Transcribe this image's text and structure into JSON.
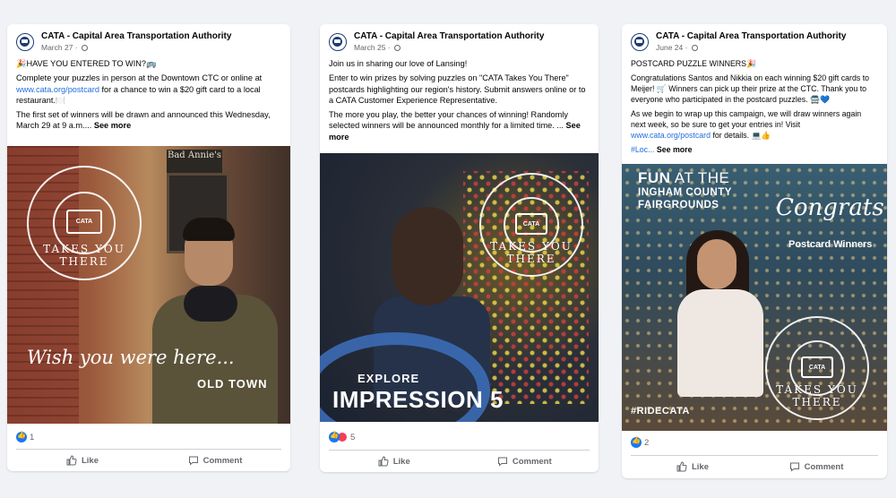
{
  "cards": [
    {
      "page_name": "CATA - Capital Area Transportation Authority",
      "date": "March 27",
      "meta_sep": " · ",
      "p1": "🎉HAVE YOU ENTERED TO WIN?🚌",
      "p2a": "Complete your puzzles in person at the Downtown CTC or online at ",
      "p2_link": "www.cata.org/postcard",
      "p2b": " for a chance to win a $20 gift card to a local restaurant.🍽️",
      "p3a": "The first set of winners will be drawn and announced this Wednesday, March 29 at 9 a.m.... ",
      "see_more": "See more",
      "image": {
        "sign": "Bad Annie's",
        "caption": "Wish you were here...",
        "place": "OLD TOWN",
        "badge_text": "TAKES YOU THERE",
        "badge_label": "CATA"
      },
      "reactions_count": "1",
      "like_label": "Like",
      "comment_label": "Comment"
    },
    {
      "page_name": "CATA - Capital Area Transportation Authority",
      "date": "March 25",
      "meta_sep": " · ",
      "p1": "Join us in sharing our love of Lansing!",
      "p2": "Enter to win prizes by solving puzzles on \"CATA Takes You There\" postcards highlighting our region's history. Submit answers online or to a CATA Customer Experience Representative.",
      "p3a": "The more you play, the better your chances of winning! Randomly selected winners will be announced monthly for a limited time. ... ",
      "see_more": "See more",
      "image": {
        "explore": "EXPLORE",
        "impression": "IMPRESSION 5",
        "badge_text": "TAKES YOU THERE",
        "badge_label": "CATA"
      },
      "reactions_count": "5",
      "like_label": "Like",
      "comment_label": "Comment"
    },
    {
      "page_name": "CATA - Capital Area Transportation Authority",
      "date": "June 24",
      "meta_sep": " · ",
      "p1": "POSTCARD PUZZLE WINNERS🎉",
      "p2": "Congratulations Santos and Nikkia on each winning $20 gift cards to Meijer! 🛒 Winners can pick up their prize at the CTC. Thank you to everyone who participated in the postcard puzzles. 🚍💙",
      "p3a": "As we begin to wrap up this campaign, we will draw winners again next week, so be sure to get your entries in! Visit ",
      "p3_link": "www.cata.org/postcard",
      "p3b": " for details. 💻👍",
      "p4a": "#Loc... ",
      "see_more": "See more",
      "image": {
        "fun_a": "FUN",
        "fun_b": " AT THE",
        "fair": "INGHAM COUNTY FAIRGROUNDS",
        "congrats": "Congrats",
        "postcard_winners": "Postcard Winners",
        "hashtag": "#RIDECATA",
        "badge_text": "TAKES YOU THERE",
        "badge_label": "CATA"
      },
      "reactions_count": "2",
      "like_label": "Like",
      "comment_label": "Comment"
    }
  ],
  "colors": {
    "link": "#216fdb",
    "like_blue": "#1877f2",
    "love_red": "#f33e58",
    "background": "#f0f2f5"
  },
  "icons": [
    "like-icon",
    "comment-icon",
    "globe-icon",
    "heart-reaction-icon",
    "like-reaction-icon"
  ]
}
